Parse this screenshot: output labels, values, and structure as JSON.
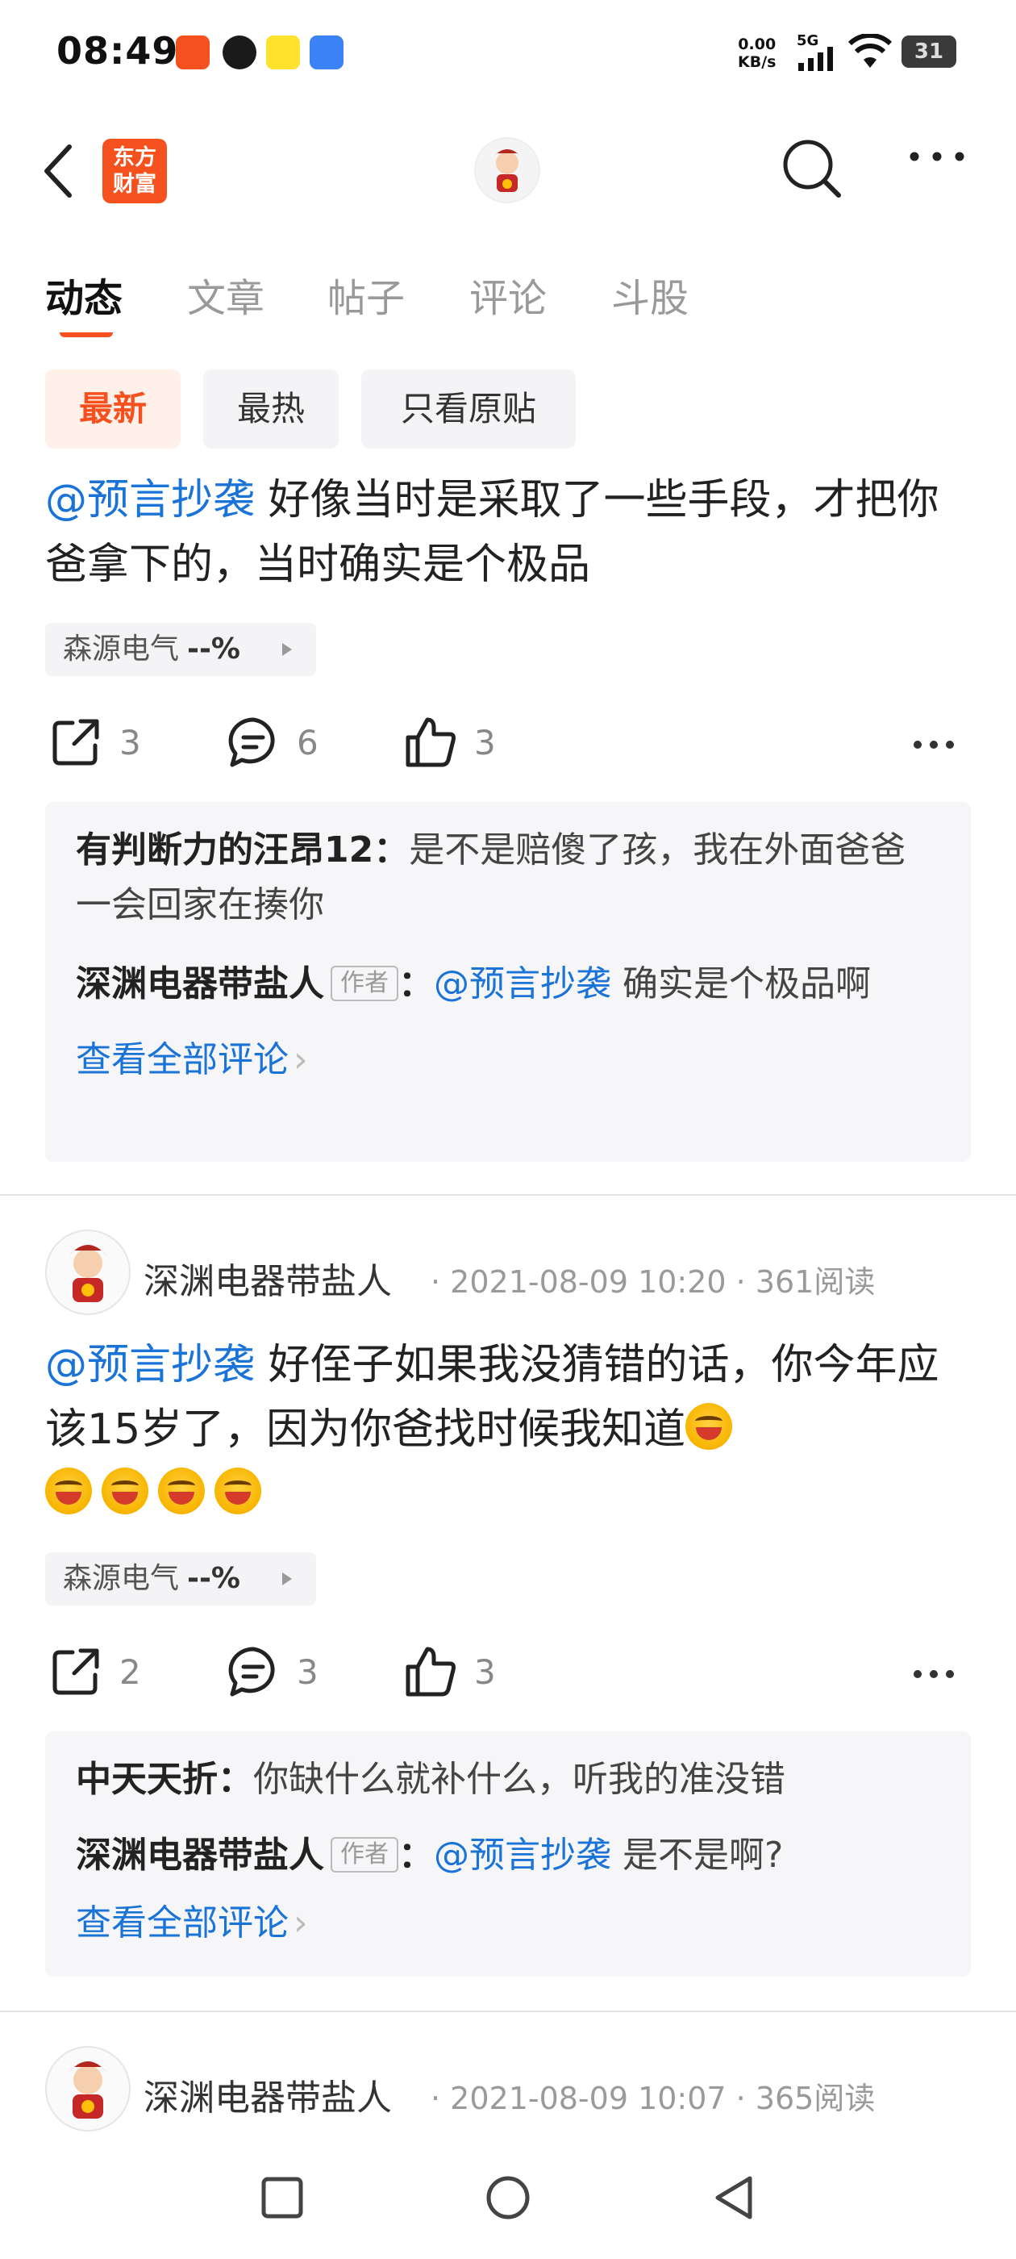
{
  "status_bar": {
    "time": "08:49",
    "net_speed_value": "0.00",
    "net_speed_unit": "KB/s",
    "network": "5G",
    "battery": "31"
  },
  "header": {
    "logo_text_line1": "东方",
    "logo_text_line2": "财富"
  },
  "tabs": [
    {
      "label": "动态"
    },
    {
      "label": "文章"
    },
    {
      "label": "帖子"
    },
    {
      "label": "评论"
    },
    {
      "label": "斗股"
    }
  ],
  "filters": [
    {
      "label": "最新"
    },
    {
      "label": "最热"
    },
    {
      "label": "只看原贴"
    }
  ],
  "posts": [
    {
      "mention": "@预言抄袭",
      "text": " 好像当时是采取了一些手段，才把你爸拿下的，当时确实是个极品",
      "stock": {
        "name": "森源电气",
        "pct": "--%"
      },
      "shares": "3",
      "comments": "6",
      "likes": "3",
      "replies": [
        {
          "who": "有判断力的汪昂12：",
          "text": "是不是赔傻了孩，我在外面爸爸一会回家在揍你"
        },
        {
          "who": "深渊电器带盐人",
          "badge": "作者",
          "colon": "：",
          "mention": "@预言抄袭",
          "text": " 确实是个极品啊"
        }
      ],
      "view_all": "查看全部评论"
    },
    {
      "author": "深渊电器带盐人",
      "meta": "· 2021-08-09 10:20 · 361阅读",
      "mention": "@预言抄袭",
      "text": " 好侄子如果我没猜错的话，你今年应该15岁了，因为你爸找时候我知道",
      "stock": {
        "name": "森源电气",
        "pct": "--%"
      },
      "shares": "2",
      "comments": "3",
      "likes": "3",
      "replies": [
        {
          "who": "中天天折：",
          "text": "你缺什么就补什么，听我的准没错"
        },
        {
          "who": "深渊电器带盐人",
          "badge": "作者",
          "colon": "：",
          "mention": "@预言抄袭",
          "text": " 是不是啊?"
        }
      ],
      "view_all": "查看全部评论"
    },
    {
      "author": "深渊电器带盐人",
      "meta": "· 2021-08-09 10:07 · 365阅读"
    }
  ],
  "colors": {
    "accent": "#f4511e",
    "link": "#1a73d6",
    "muted": "#9a9a9a"
  }
}
